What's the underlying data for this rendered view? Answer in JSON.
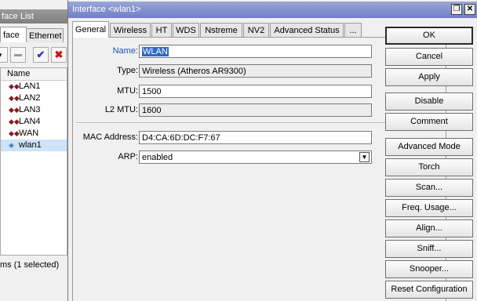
{
  "background_window": {
    "title": "face List",
    "tabs": [
      "face",
      "Ethernet"
    ],
    "column_header": "Name",
    "rows": [
      "LAN1",
      "LAN2",
      "LAN3",
      "LAN4",
      "WAN",
      "wlan1"
    ],
    "status": "ms (1 selected)"
  },
  "dialog": {
    "title": "Interface <wlan1>",
    "tabs": [
      "General",
      "Wireless",
      "HT",
      "WDS",
      "Nstreme",
      "NV2",
      "Advanced Status",
      "..."
    ],
    "active_tab": "General",
    "fields": {
      "name": {
        "label": "Name:",
        "value": "WLAN"
      },
      "type": {
        "label": "Type:",
        "value": "Wireless (Atheros AR9300)"
      },
      "mtu": {
        "label": "MTU:",
        "value": "1500"
      },
      "l2mtu": {
        "label": "L2 MTU:",
        "value": "1600"
      },
      "mac": {
        "label": "MAC Address:",
        "value": "D4:CA:6D:DC:F7:67"
      },
      "arp": {
        "label": "ARP:",
        "value": "enabled"
      }
    },
    "buttons": {
      "ok": "OK",
      "cancel": "Cancel",
      "apply": "Apply",
      "disable": "Disable",
      "comment": "Comment",
      "advanced_mode": "Advanced Mode",
      "torch": "Torch",
      "scan": "Scan...",
      "freq_usage": "Freq. Usage...",
      "align": "Align...",
      "sniff": "Sniff...",
      "snooper": "Snooper...",
      "reset_configuration": "Reset Configuration"
    }
  },
  "icons": {
    "restore": "restore-icon",
    "close": "close-icon",
    "dropdown": "dropdown-arrow-icon",
    "ethernet_port": "ethernet-port-icon",
    "wireless": "wireless-icon"
  },
  "colors": {
    "title_bar": "#7f8fd0",
    "label_highlight": "#2050c0",
    "selection": "#3168c6"
  }
}
